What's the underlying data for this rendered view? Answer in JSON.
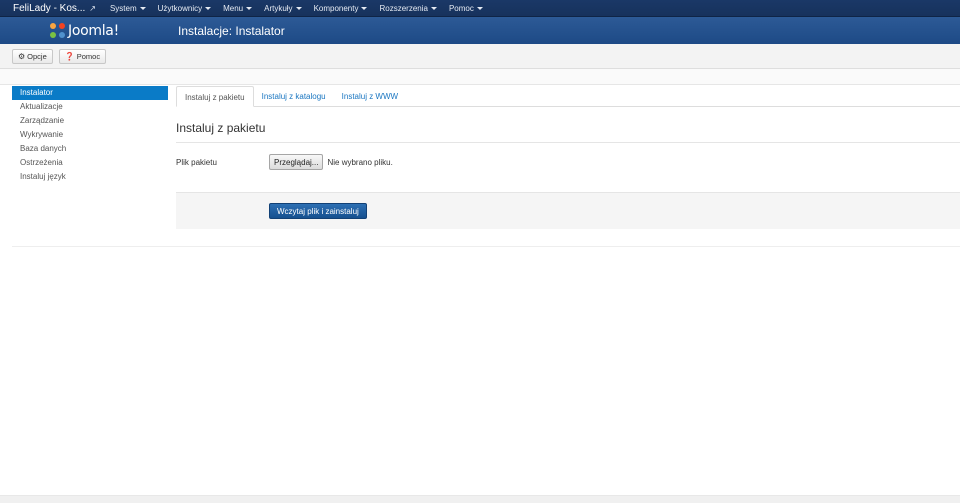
{
  "navbar": {
    "site_name": "FeliLady - Kos...",
    "menu": [
      {
        "label": "System"
      },
      {
        "label": "Użytkownicy"
      },
      {
        "label": "Menu"
      },
      {
        "label": "Artykuły"
      },
      {
        "label": "Komponenty"
      },
      {
        "label": "Rozszerzenia"
      },
      {
        "label": "Pomoc"
      }
    ]
  },
  "header": {
    "logo_text": "Joomla!",
    "title": "Instalacje: Instalator"
  },
  "toolbar": {
    "options_label": "Opcje",
    "help_label": "Pomoc"
  },
  "sidebar": {
    "items": [
      {
        "label": "Instalator"
      },
      {
        "label": "Aktualizacje"
      },
      {
        "label": "Zarządzanie"
      },
      {
        "label": "Wykrywanie"
      },
      {
        "label": "Baza danych"
      },
      {
        "label": "Ostrzeżenia"
      },
      {
        "label": "Instaluj język"
      }
    ]
  },
  "tabs": [
    {
      "label": "Instaluj z pakietu"
    },
    {
      "label": "Instaluj z katalogu"
    },
    {
      "label": "Instaluj z WWW"
    }
  ],
  "form": {
    "section_title": "Instaluj z pakietu",
    "file_label": "Plik pakietu",
    "browse_label": "Przeglądaj...",
    "file_status": "Nie wybrano pliku.",
    "submit_label": "Wczytaj plik i zainstaluj"
  },
  "colors": {
    "navbar": "#17325c",
    "header": "#2d5a96",
    "accent": "#0a7bc7"
  }
}
